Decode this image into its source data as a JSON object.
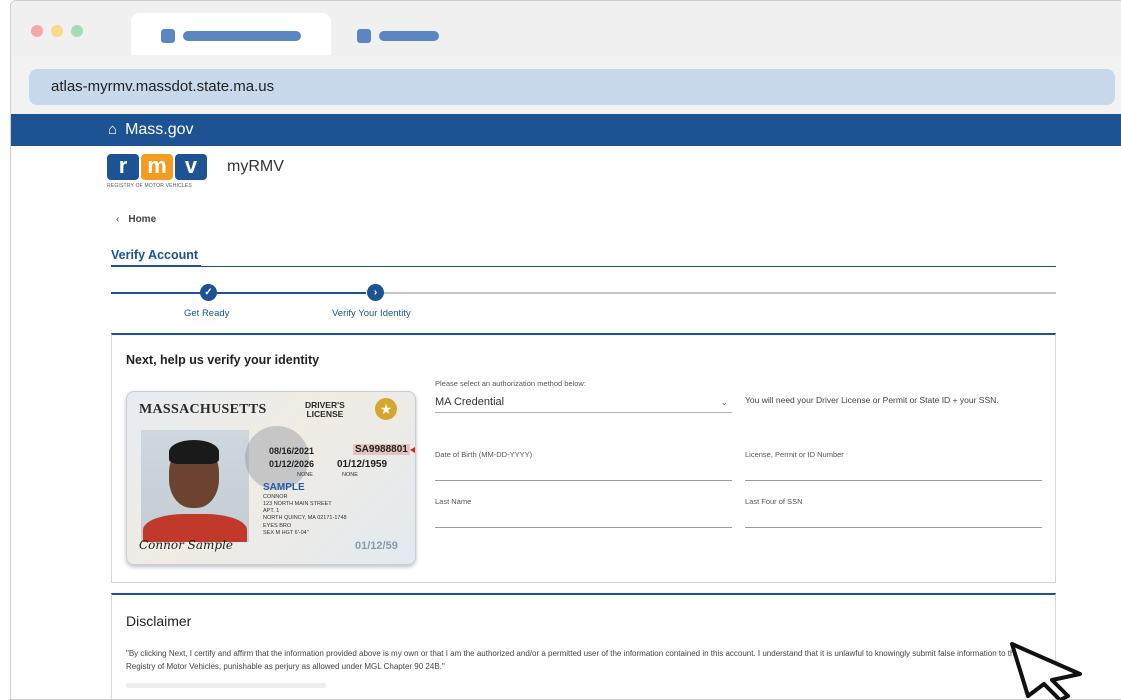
{
  "browser": {
    "url": "atlas-myrmv.massdot.state.ma.us"
  },
  "topbar": {
    "home_icon": "home-icon",
    "site_name": "Mass.gov"
  },
  "brand": {
    "logo_letters": [
      "r",
      "m",
      "v"
    ],
    "logo_subtitle": "REGISTRY OF MOTOR VEHICLES",
    "app_name": "myRMV"
  },
  "nav": {
    "back_icon": "chevron-left-icon",
    "back_label": "Home"
  },
  "page": {
    "heading": "Verify Account"
  },
  "stepper": {
    "steps": [
      {
        "label": "Get Ready",
        "status": "complete",
        "icon": "check-icon",
        "glyph": "✓"
      },
      {
        "label": "Verify Your Identity",
        "status": "current",
        "icon": "chevron-right-icon",
        "glyph": "›"
      }
    ]
  },
  "verify_card": {
    "title": "Next, help us verify your identity",
    "sample_license": {
      "state": "MASSACHUSETTS",
      "type_line1": "DRIVER'S",
      "type_line2": "LICENSE",
      "issue_date": "08/16/2021",
      "expiry_date": "01/12/2026",
      "dob": "01/12/1959",
      "license_number": "SA9988801",
      "class": "NONE",
      "endorsements": "NONE",
      "sample_word": "SAMPLE",
      "last_name": "CONNOR",
      "address1": "123 NORTH MAIN STREET",
      "address2": "APT. 1",
      "address3": "NORTH QUINCY, MA 02171-1748",
      "eyes": "EYES BRO",
      "sex_height": "SEX M   HGT 6'-04\"",
      "signature": "Connor Sample",
      "dob_short": "01/12/59"
    },
    "auth_label": "Please select an authorization method below:",
    "auth_value": "MA Credential",
    "auth_chevron": "chevron-down-icon",
    "info_text": "You will need your Driver License or Permit or State ID + your SSN.",
    "fields": {
      "dob_label": "Date of Birth (MM-DD-YYYY)",
      "license_label": "License, Permit or ID Number",
      "last_name_label": "Last Name",
      "ssn_label": "Last Four of SSN"
    }
  },
  "disclaimer": {
    "title": "Disclaimer",
    "text": "\"By clicking Next, I certify and affirm that the information provided above is my own or that I am the authorized and/or a permitted user of the information contained in this account. I understand that it is unlawful to knowingly submit false information to the Registry of Motor Vehicles, punishable as perjury as allowed under MGL Chapter 90 24B.\""
  },
  "colors": {
    "brand_blue": "#1d5293",
    "brand_orange": "#f39c1f",
    "address_bar": "#c9d9ec",
    "alert_red": "#e02020"
  }
}
